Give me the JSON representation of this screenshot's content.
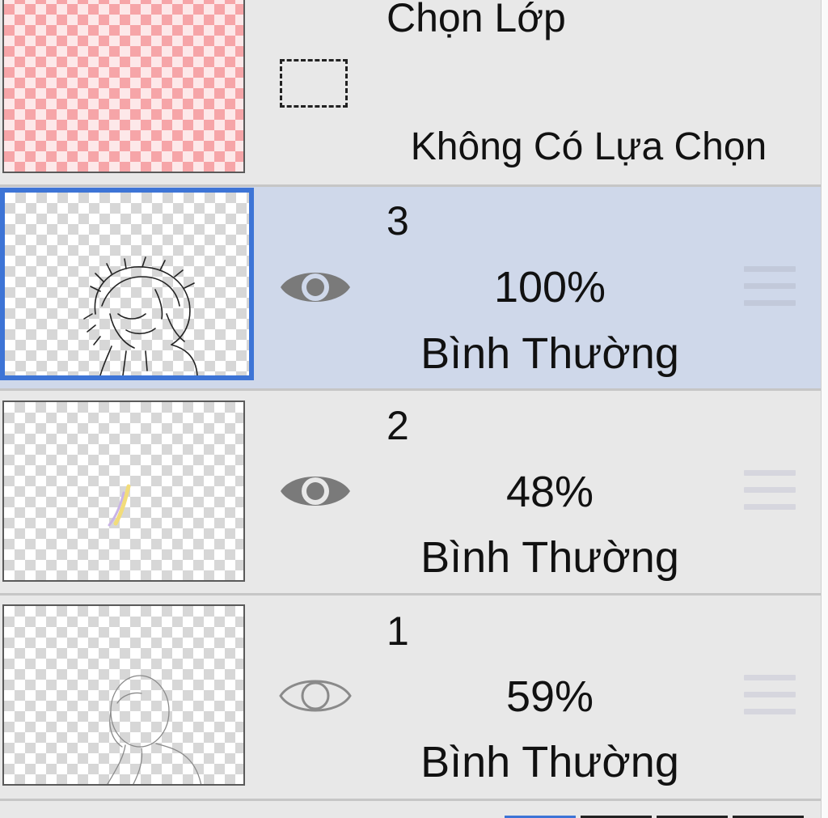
{
  "selection_layer": {
    "title": "Chọn Lớp",
    "status": "Không Có Lựa Chọn",
    "icon": "dashed-rectangle-icon",
    "thumbnail_color": "#f6a5a8"
  },
  "layers": [
    {
      "name": "3",
      "opacity": "100%",
      "blend_mode": "Bình Thường",
      "visible": true,
      "selected": true
    },
    {
      "name": "2",
      "opacity": "48%",
      "blend_mode": "Bình Thường",
      "visible": true,
      "selected": false
    },
    {
      "name": "1",
      "opacity": "59%",
      "blend_mode": "Bình Thường",
      "visible": false,
      "selected": false
    }
  ],
  "colors": {
    "selected_row": "#cfd8ea",
    "selected_border": "#3d74d6",
    "row_background": "#e8e8e8"
  }
}
